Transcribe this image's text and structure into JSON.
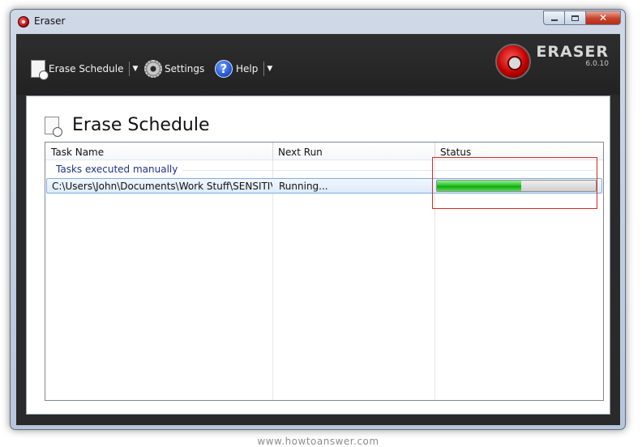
{
  "window": {
    "title": "Eraser",
    "minimize": "minimize",
    "maximize": "maximize",
    "close": "close",
    "close_glyph": "✕"
  },
  "toolbar": {
    "erase_schedule": "Erase Schedule",
    "settings": "Settings",
    "help": "Help",
    "help_glyph": "?",
    "dropdown_glyph": "▼"
  },
  "logo": {
    "name": "ERASER",
    "version": "6.0.10"
  },
  "page": {
    "title": "Erase Schedule"
  },
  "list": {
    "columns": [
      "Task Name",
      "Next Run",
      "Status"
    ],
    "group_label": "Tasks executed manually",
    "rows": [
      {
        "task_name": "C:\\Users\\John\\Documents\\Work Stuff\\SENSITIVE...",
        "next_run": "Running...",
        "progress": 0.53
      }
    ]
  },
  "watermark": "www.howtoanswer.com",
  "colors": {
    "accent_red": "#d42a2a",
    "progress_green": "#2fc42f",
    "group_text": "#1e3287"
  }
}
